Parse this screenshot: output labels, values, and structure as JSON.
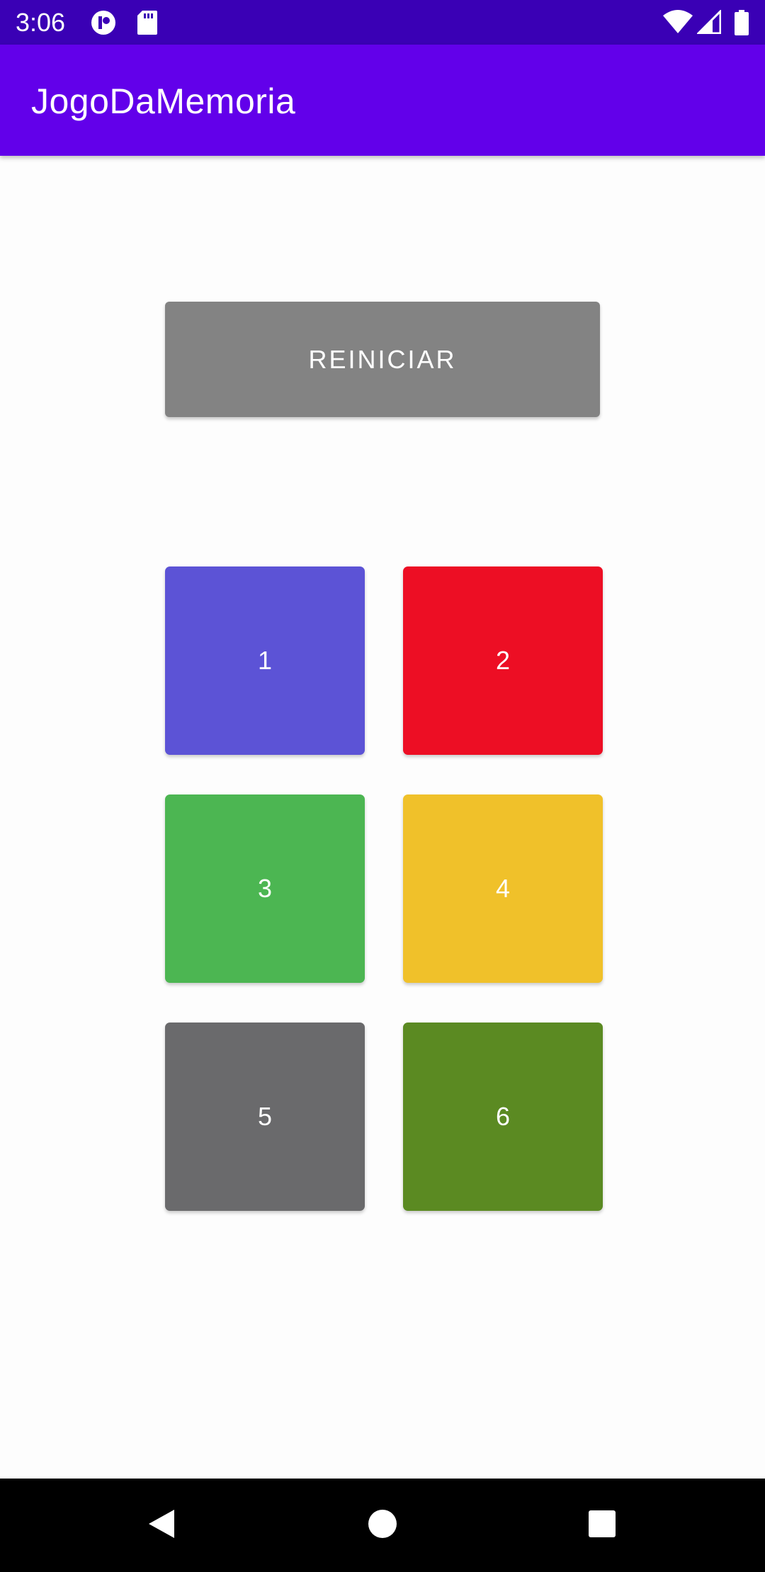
{
  "status_bar": {
    "time": "3:06",
    "left_icons": [
      "app-notification-icon",
      "sd-card-icon"
    ],
    "right_icons": [
      "wifi-icon",
      "signal-icon",
      "battery-icon"
    ]
  },
  "app_bar": {
    "title": "JogoDaMemoria"
  },
  "restart_button": {
    "label": "REINICIAR"
  },
  "cards": [
    {
      "label": "1",
      "color": "#5c53d6"
    },
    {
      "label": "2",
      "color": "#ed0e24"
    },
    {
      "label": "3",
      "color": "#4cb652"
    },
    {
      "label": "4",
      "color": "#f0c12a"
    },
    {
      "label": "5",
      "color": "#6a6a6c"
    },
    {
      "label": "6",
      "color": "#5b8a22"
    }
  ],
  "nav_bar": {
    "buttons": [
      "back-icon",
      "home-icon",
      "recents-icon"
    ]
  },
  "colors": {
    "status_bar": "#3a00b5",
    "app_bar": "#6200ea",
    "background": "#fdfdfd",
    "button": "#838383"
  }
}
